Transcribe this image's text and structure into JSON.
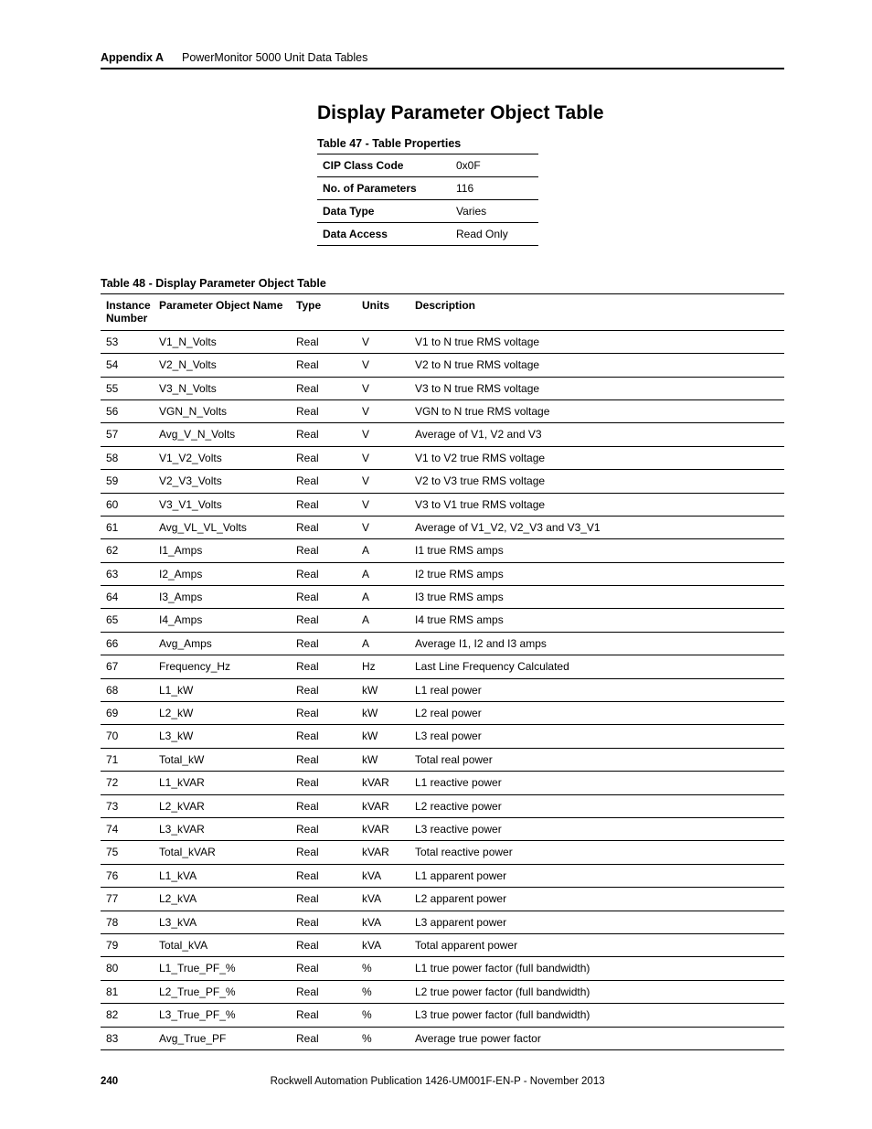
{
  "header": {
    "appendix": "Appendix A",
    "chapter": "PowerMonitor 5000 Unit Data Tables"
  },
  "section_title": "Display Parameter Object Table",
  "table47": {
    "caption": "Table 47 - Table Properties",
    "rows": [
      {
        "label": "CIP Class Code",
        "value": "0x0F"
      },
      {
        "label": "No. of Parameters",
        "value": "116"
      },
      {
        "label": "Data Type",
        "value": "Varies"
      },
      {
        "label": "Data Access",
        "value": "Read Only"
      }
    ]
  },
  "table48": {
    "caption": "Table 48 - Display Parameter Object Table",
    "headers": {
      "instance": "Instance Number",
      "name": "Parameter Object Name",
      "type": "Type",
      "units": "Units",
      "desc": "Description"
    },
    "rows": [
      {
        "instance": "53",
        "name": "V1_N_Volts",
        "type": "Real",
        "units": "V",
        "desc": "V1 to N true RMS voltage"
      },
      {
        "instance": "54",
        "name": "V2_N_Volts",
        "type": "Real",
        "units": "V",
        "desc": "V2 to N true RMS voltage"
      },
      {
        "instance": "55",
        "name": "V3_N_Volts",
        "type": "Real",
        "units": "V",
        "desc": "V3 to N true RMS voltage"
      },
      {
        "instance": "56",
        "name": "VGN_N_Volts",
        "type": "Real",
        "units": "V",
        "desc": "VGN to N true RMS voltage"
      },
      {
        "instance": "57",
        "name": "Avg_V_N_Volts",
        "type": "Real",
        "units": "V",
        "desc": "Average of V1, V2 and V3"
      },
      {
        "instance": "58",
        "name": "V1_V2_Volts",
        "type": "Real",
        "units": "V",
        "desc": "V1 to V2 true RMS voltage"
      },
      {
        "instance": "59",
        "name": "V2_V3_Volts",
        "type": "Real",
        "units": "V",
        "desc": "V2 to V3 true RMS voltage"
      },
      {
        "instance": "60",
        "name": "V3_V1_Volts",
        "type": "Real",
        "units": "V",
        "desc": "V3 to V1 true RMS voltage"
      },
      {
        "instance": "61",
        "name": "Avg_VL_VL_Volts",
        "type": "Real",
        "units": "V",
        "desc": "Average of V1_V2, V2_V3 and V3_V1"
      },
      {
        "instance": "62",
        "name": "I1_Amps",
        "type": "Real",
        "units": "A",
        "desc": "I1 true RMS amps"
      },
      {
        "instance": "63",
        "name": "I2_Amps",
        "type": "Real",
        "units": "A",
        "desc": "I2 true RMS amps"
      },
      {
        "instance": "64",
        "name": "I3_Amps",
        "type": "Real",
        "units": "A",
        "desc": "I3 true RMS amps"
      },
      {
        "instance": "65",
        "name": "I4_Amps",
        "type": "Real",
        "units": "A",
        "desc": "I4 true RMS amps"
      },
      {
        "instance": "66",
        "name": "Avg_Amps",
        "type": "Real",
        "units": "A",
        "desc": "Average I1, I2 and I3 amps"
      },
      {
        "instance": "67",
        "name": "Frequency_Hz",
        "type": "Real",
        "units": "Hz",
        "desc": "Last Line Frequency Calculated"
      },
      {
        "instance": "68",
        "name": "L1_kW",
        "type": "Real",
        "units": "kW",
        "desc": "L1 real power"
      },
      {
        "instance": "69",
        "name": "L2_kW",
        "type": "Real",
        "units": "kW",
        "desc": "L2 real power"
      },
      {
        "instance": "70",
        "name": "L3_kW",
        "type": "Real",
        "units": "kW",
        "desc": "L3 real power"
      },
      {
        "instance": "71",
        "name": "Total_kW",
        "type": "Real",
        "units": "kW",
        "desc": "Total real power"
      },
      {
        "instance": "72",
        "name": "L1_kVAR",
        "type": "Real",
        "units": "kVAR",
        "desc": "L1 reactive power"
      },
      {
        "instance": "73",
        "name": "L2_kVAR",
        "type": "Real",
        "units": "kVAR",
        "desc": "L2 reactive power"
      },
      {
        "instance": "74",
        "name": "L3_kVAR",
        "type": "Real",
        "units": "kVAR",
        "desc": "L3 reactive power"
      },
      {
        "instance": "75",
        "name": "Total_kVAR",
        "type": "Real",
        "units": "kVAR",
        "desc": "Total reactive power"
      },
      {
        "instance": "76",
        "name": "L1_kVA",
        "type": "Real",
        "units": "kVA",
        "desc": "L1 apparent power"
      },
      {
        "instance": "77",
        "name": "L2_kVA",
        "type": "Real",
        "units": "kVA",
        "desc": "L2 apparent power"
      },
      {
        "instance": "78",
        "name": "L3_kVA",
        "type": "Real",
        "units": "kVA",
        "desc": "L3 apparent power"
      },
      {
        "instance": "79",
        "name": "Total_kVA",
        "type": "Real",
        "units": "kVA",
        "desc": "Total apparent power"
      },
      {
        "instance": "80",
        "name": "L1_True_PF_%",
        "type": "Real",
        "units": "%",
        "desc": "L1 true power factor (full bandwidth)"
      },
      {
        "instance": "81",
        "name": "L2_True_PF_%",
        "type": "Real",
        "units": "%",
        "desc": "L2 true power factor (full bandwidth)"
      },
      {
        "instance": "82",
        "name": "L3_True_PF_%",
        "type": "Real",
        "units": "%",
        "desc": "L3 true power factor (full bandwidth)"
      },
      {
        "instance": "83",
        "name": "Avg_True_PF",
        "type": "Real",
        "units": "%",
        "desc": "Average true power factor"
      }
    ]
  },
  "footer": {
    "page": "240",
    "publication": "Rockwell Automation Publication 1426-UM001F-EN-P - November 2013"
  }
}
